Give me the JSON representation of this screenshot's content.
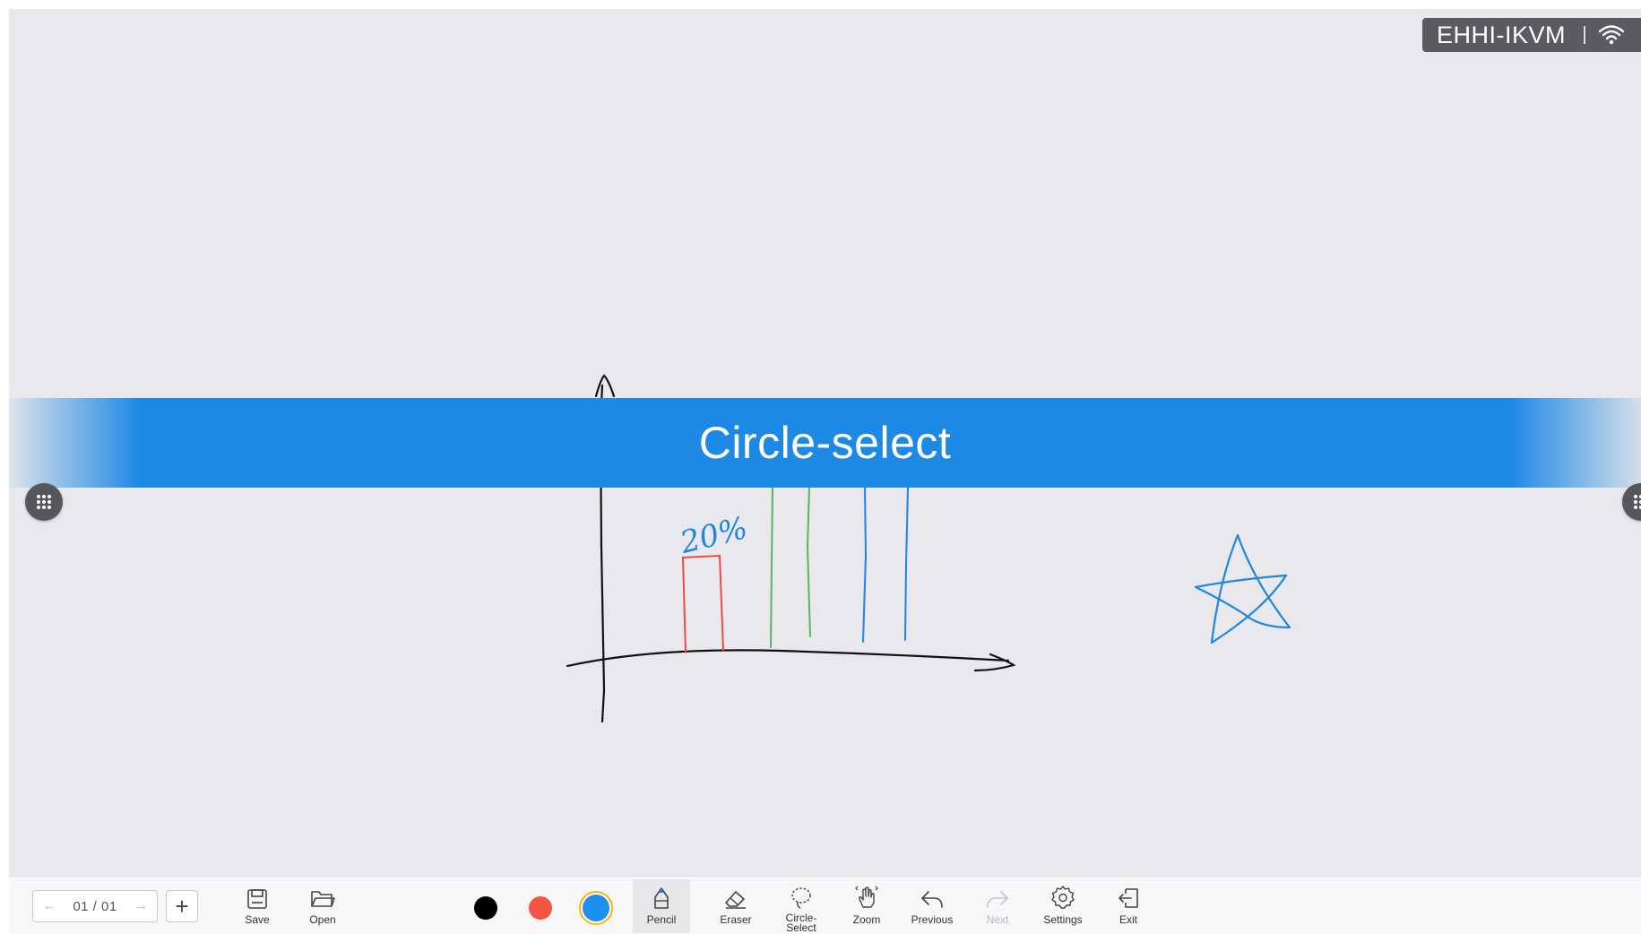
{
  "device": {
    "name": "EHHI-IKVM",
    "wifi_icon": "wifi-icon"
  },
  "banner": {
    "title": "Circle-select"
  },
  "drawing": {
    "annotation": "20%"
  },
  "pager": {
    "current": "01 / 01"
  },
  "toolbar": {
    "save": "Save",
    "open": "Open",
    "pencil": "Pencil",
    "eraser": "Eraser",
    "circle_select": "Circle-\nSelect",
    "zoom": "Zoom",
    "previous": "Previous",
    "next": "Next",
    "settings": "Settings",
    "exit": "Exit"
  },
  "colors": {
    "black": "#000000",
    "red": "#f25544",
    "blue": "#1e90ee",
    "accent": "#1e88e5"
  }
}
